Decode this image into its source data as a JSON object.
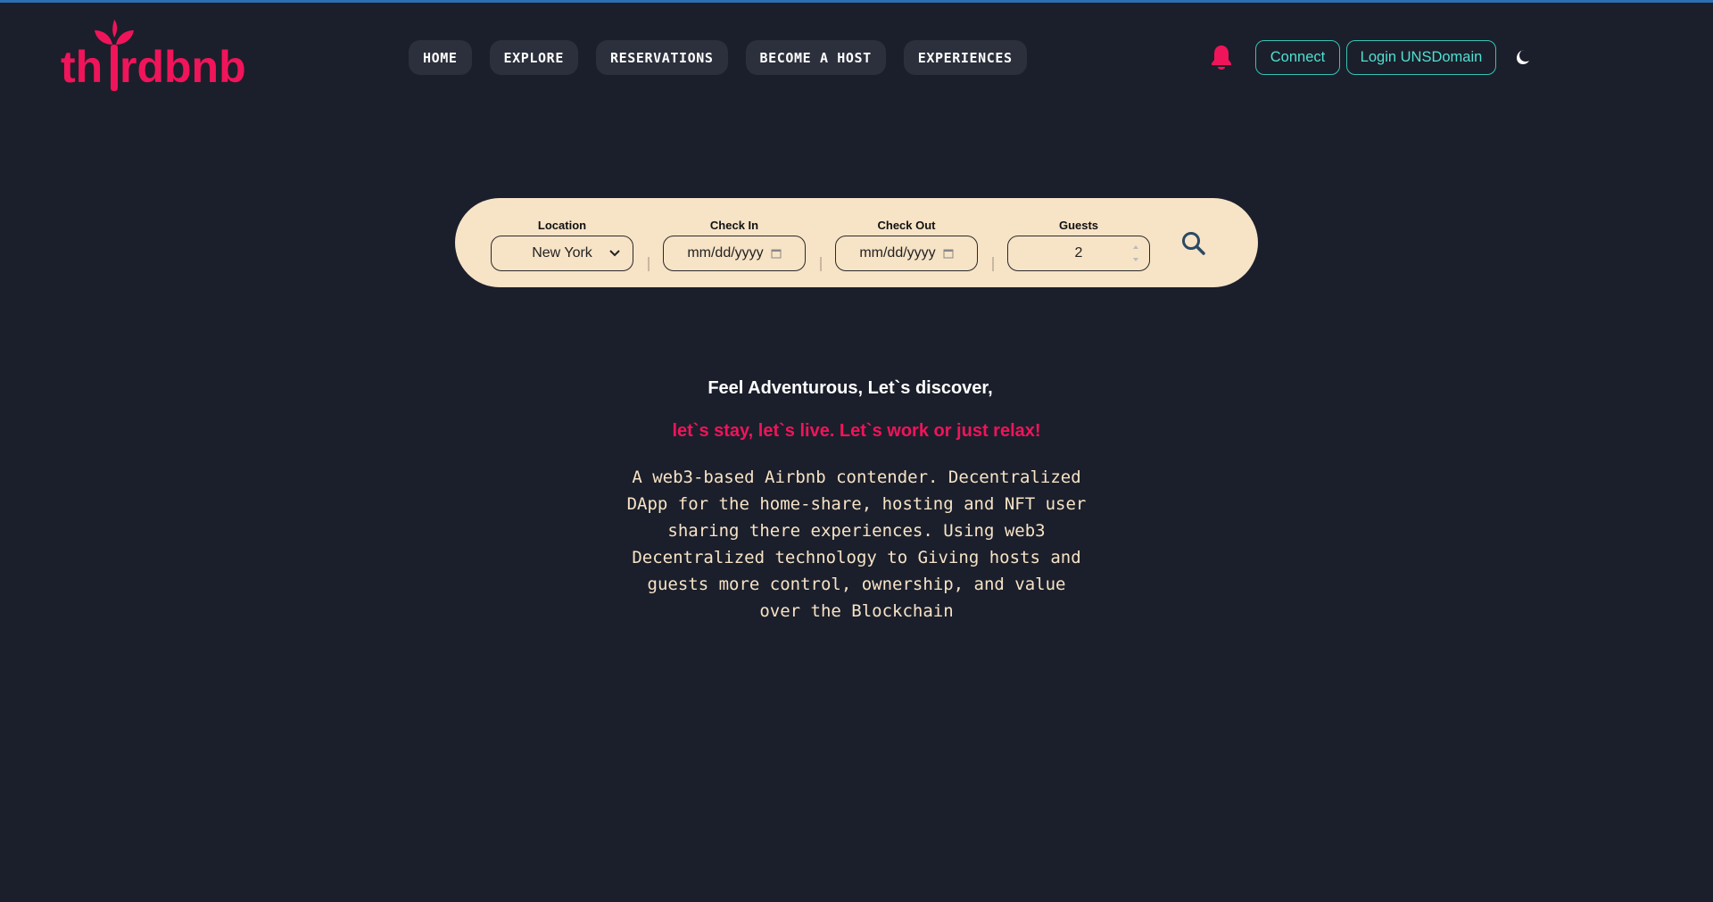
{
  "brand": {
    "logo_text": "thirdbnb"
  },
  "nav": {
    "items": [
      {
        "label": "HOME"
      },
      {
        "label": "EXPLORE"
      },
      {
        "label": "RESERVATIONS"
      },
      {
        "label": "BECOME A HOST"
      },
      {
        "label": "EXPERIENCES"
      }
    ]
  },
  "header": {
    "connect_label": "Connect",
    "login_label": "Login UNSDomain",
    "bell_icon": "bell-icon",
    "theme_icon": "moon-icon"
  },
  "search": {
    "location": {
      "label": "Location",
      "value": "New York"
    },
    "check_in": {
      "label": "Check In",
      "placeholder": "mm/dd/yyyy"
    },
    "check_out": {
      "label": "Check Out",
      "placeholder": "mm/dd/yyyy"
    },
    "guests": {
      "label": "Guests",
      "value": "2"
    }
  },
  "hero": {
    "title": "Feel Adventurous, Let`s discover,",
    "subtitle": "let`s stay, let`s live. Let`s work or just relax!",
    "description": "A web3-based Airbnb contender. Decentralized DApp for the home-share, hosting and NFT user sharing there experiences. Using web3 Decentralized technology to Giving hosts and guests more control, ownership, and value over the Blockchain"
  },
  "colors": {
    "background": "#1b1f2b",
    "brand_pink": "#f0145a",
    "accent_teal": "#36c2b4",
    "search_bg": "#f7e3c6",
    "nav_btn_bg": "#2c303c"
  }
}
